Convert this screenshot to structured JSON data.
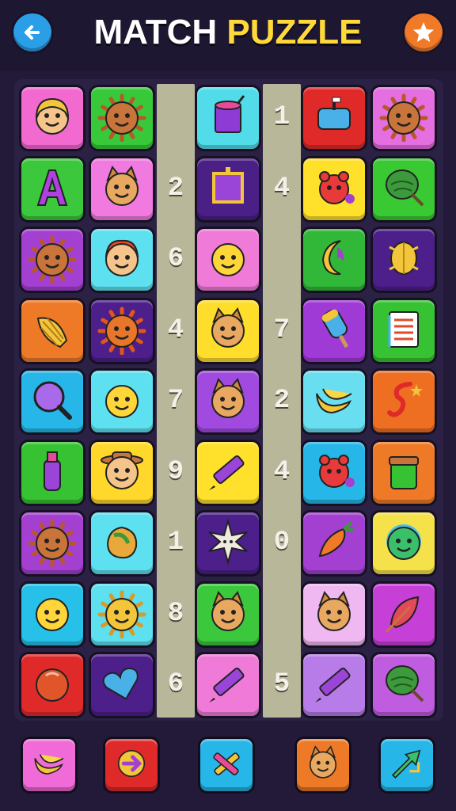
{
  "header": {
    "title_part1": "MATCH",
    "title_part2": "PUZZLE",
    "back_icon": "arrow-left-icon",
    "star_icon": "star-icon"
  },
  "colors": {
    "background": "#231a3a",
    "board": "#2b2145",
    "strip": "#b9b79a",
    "title_accent": "#ffd93b"
  },
  "grid": {
    "rows": 9,
    "columns": 6,
    "rows_data": [
      {
        "tiles": [
          {
            "col": 0,
            "color": "#f26ad0",
            "icon": "smiley-girl-icon"
          },
          {
            "col": 1,
            "color": "#37c93a",
            "icon": "sun-face-icon"
          },
          {
            "col": 2,
            "color": "#52dce9",
            "icon": "paint-bucket-icon"
          },
          {
            "col": 4,
            "color": "#e02a2a",
            "icon": "mailbox-icon"
          },
          {
            "col": 5,
            "color": "#e56ee0",
            "icon": "sun-face-icon"
          }
        ],
        "numbers": [
          {
            "slot": "right",
            "text": "1"
          }
        ]
      },
      {
        "tiles": [
          {
            "col": 0,
            "color": "#3cc83c",
            "icon": "letter-a-icon"
          },
          {
            "col": 1,
            "color": "#f07adf",
            "icon": "cat-face-icon"
          },
          {
            "col": 2,
            "color": "#4a1f86",
            "icon": "purple-square-icon"
          },
          {
            "col": 4,
            "color": "#ffe02b",
            "icon": "red-bird-icon"
          },
          {
            "col": 5,
            "color": "#39c932",
            "icon": "leaf-icon"
          }
        ],
        "numbers": [
          {
            "slot": "left",
            "text": "2"
          },
          {
            "slot": "right",
            "text": "4"
          }
        ]
      },
      {
        "tiles": [
          {
            "col": 0,
            "color": "#a33fd1",
            "icon": "sun-face-icon"
          },
          {
            "col": 1,
            "color": "#5de0f0",
            "icon": "fox-face-icon"
          },
          {
            "col": 2,
            "color": "#f07ad8",
            "icon": "smiley-face-icon"
          },
          {
            "col": 4,
            "color": "#32b838",
            "icon": "moon-flame-icon"
          },
          {
            "col": 5,
            "color": "#4c1f8a",
            "icon": "yellow-leaf-icon"
          }
        ],
        "numbers": [
          {
            "slot": "left",
            "text": "6"
          }
        ]
      },
      {
        "tiles": [
          {
            "col": 0,
            "color": "#ee7a28",
            "icon": "seashell-icon"
          },
          {
            "col": 1,
            "color": "#4c1f8a",
            "icon": "sun-icon"
          },
          {
            "col": 2,
            "color": "#ffde2b",
            "icon": "cat-face-icon"
          },
          {
            "col": 4,
            "color": "#a03ad6",
            "icon": "ice-pop-icon"
          },
          {
            "col": 5,
            "color": "#37c233",
            "icon": "notebook-icon"
          }
        ],
        "numbers": [
          {
            "slot": "left",
            "text": "4"
          },
          {
            "slot": "right",
            "text": "7"
          }
        ]
      },
      {
        "tiles": [
          {
            "col": 0,
            "color": "#27b6e8",
            "icon": "magnifier-icon"
          },
          {
            "col": 1,
            "color": "#5de0f0",
            "icon": "smiley-face-icon"
          },
          {
            "col": 2,
            "color": "#a04ae0",
            "icon": "cat-face-icon"
          },
          {
            "col": 4,
            "color": "#68def0",
            "icon": "banana-icon"
          },
          {
            "col": 5,
            "color": "#ee6f22",
            "icon": "red-swirl-icon"
          }
        ],
        "numbers": [
          {
            "slot": "left",
            "text": "7"
          },
          {
            "slot": "right",
            "text": "2"
          }
        ]
      },
      {
        "tiles": [
          {
            "col": 0,
            "color": "#37c233",
            "icon": "bottle-icon"
          },
          {
            "col": 1,
            "color": "#ffd82b",
            "icon": "cowboy-face-icon"
          },
          {
            "col": 2,
            "color": "#ffe02b",
            "icon": "crayon-icon"
          },
          {
            "col": 4,
            "color": "#27b6e8",
            "icon": "red-bird-icon"
          },
          {
            "col": 5,
            "color": "#ee7a28",
            "icon": "jar-icon"
          }
        ],
        "numbers": [
          {
            "slot": "left",
            "text": "9"
          },
          {
            "slot": "right",
            "text": "4"
          }
        ]
      },
      {
        "tiles": [
          {
            "col": 0,
            "color": "#a33fd1",
            "icon": "sun-face-icon"
          },
          {
            "col": 1,
            "color": "#5de0f0",
            "icon": "mango-icon"
          },
          {
            "col": 2,
            "color": "#4c1f8a",
            "icon": "sparkle-icon"
          },
          {
            "col": 4,
            "color": "#a33fd1",
            "icon": "carrot-icon"
          },
          {
            "col": 5,
            "color": "#f5e24a",
            "icon": "rainbow-face-icon"
          }
        ],
        "numbers": [
          {
            "slot": "left",
            "text": "1"
          },
          {
            "slot": "right",
            "text": "0"
          }
        ]
      },
      {
        "tiles": [
          {
            "col": 0,
            "color": "#27c0e8",
            "icon": "smiley-face-icon"
          },
          {
            "col": 1,
            "color": "#5de0f0",
            "icon": "lion-face-icon"
          },
          {
            "col": 2,
            "color": "#3cc83c",
            "icon": "cat-face-icon"
          },
          {
            "col": 4,
            "color": "#f0b8f0",
            "icon": "cat-face-icon"
          },
          {
            "col": 5,
            "color": "#c63fd6",
            "icon": "feather-icon"
          }
        ],
        "numbers": [
          {
            "slot": "left",
            "text": "8"
          }
        ]
      },
      {
        "tiles": [
          {
            "col": 0,
            "color": "#e02a2a",
            "icon": "orange-ball-icon"
          },
          {
            "col": 1,
            "color": "#4c1f8a",
            "icon": "blue-heart-icon"
          },
          {
            "col": 2,
            "color": "#f07ad8",
            "icon": "crayon-icon"
          },
          {
            "col": 4,
            "color": "#b77ce8",
            "icon": "crayon-icon"
          },
          {
            "col": 5,
            "color": "#c05ce0",
            "icon": "leaf-icon"
          }
        ],
        "numbers": [
          {
            "slot": "left",
            "text": "6"
          },
          {
            "slot": "right",
            "text": "5"
          }
        ]
      }
    ]
  },
  "footer": {
    "buttons": [
      {
        "color": "#f06ad8",
        "icon": "banana-icon"
      },
      {
        "color": "#e02a2a",
        "icon": "arrow-right-icon"
      },
      {
        "color": "#27b6e8",
        "icon": "crossed-crayons-icon"
      },
      {
        "color": "#ee7a28",
        "icon": "cat-face-icon"
      },
      {
        "color": "#27b6e8",
        "icon": "green-arrow-icon"
      }
    ]
  }
}
